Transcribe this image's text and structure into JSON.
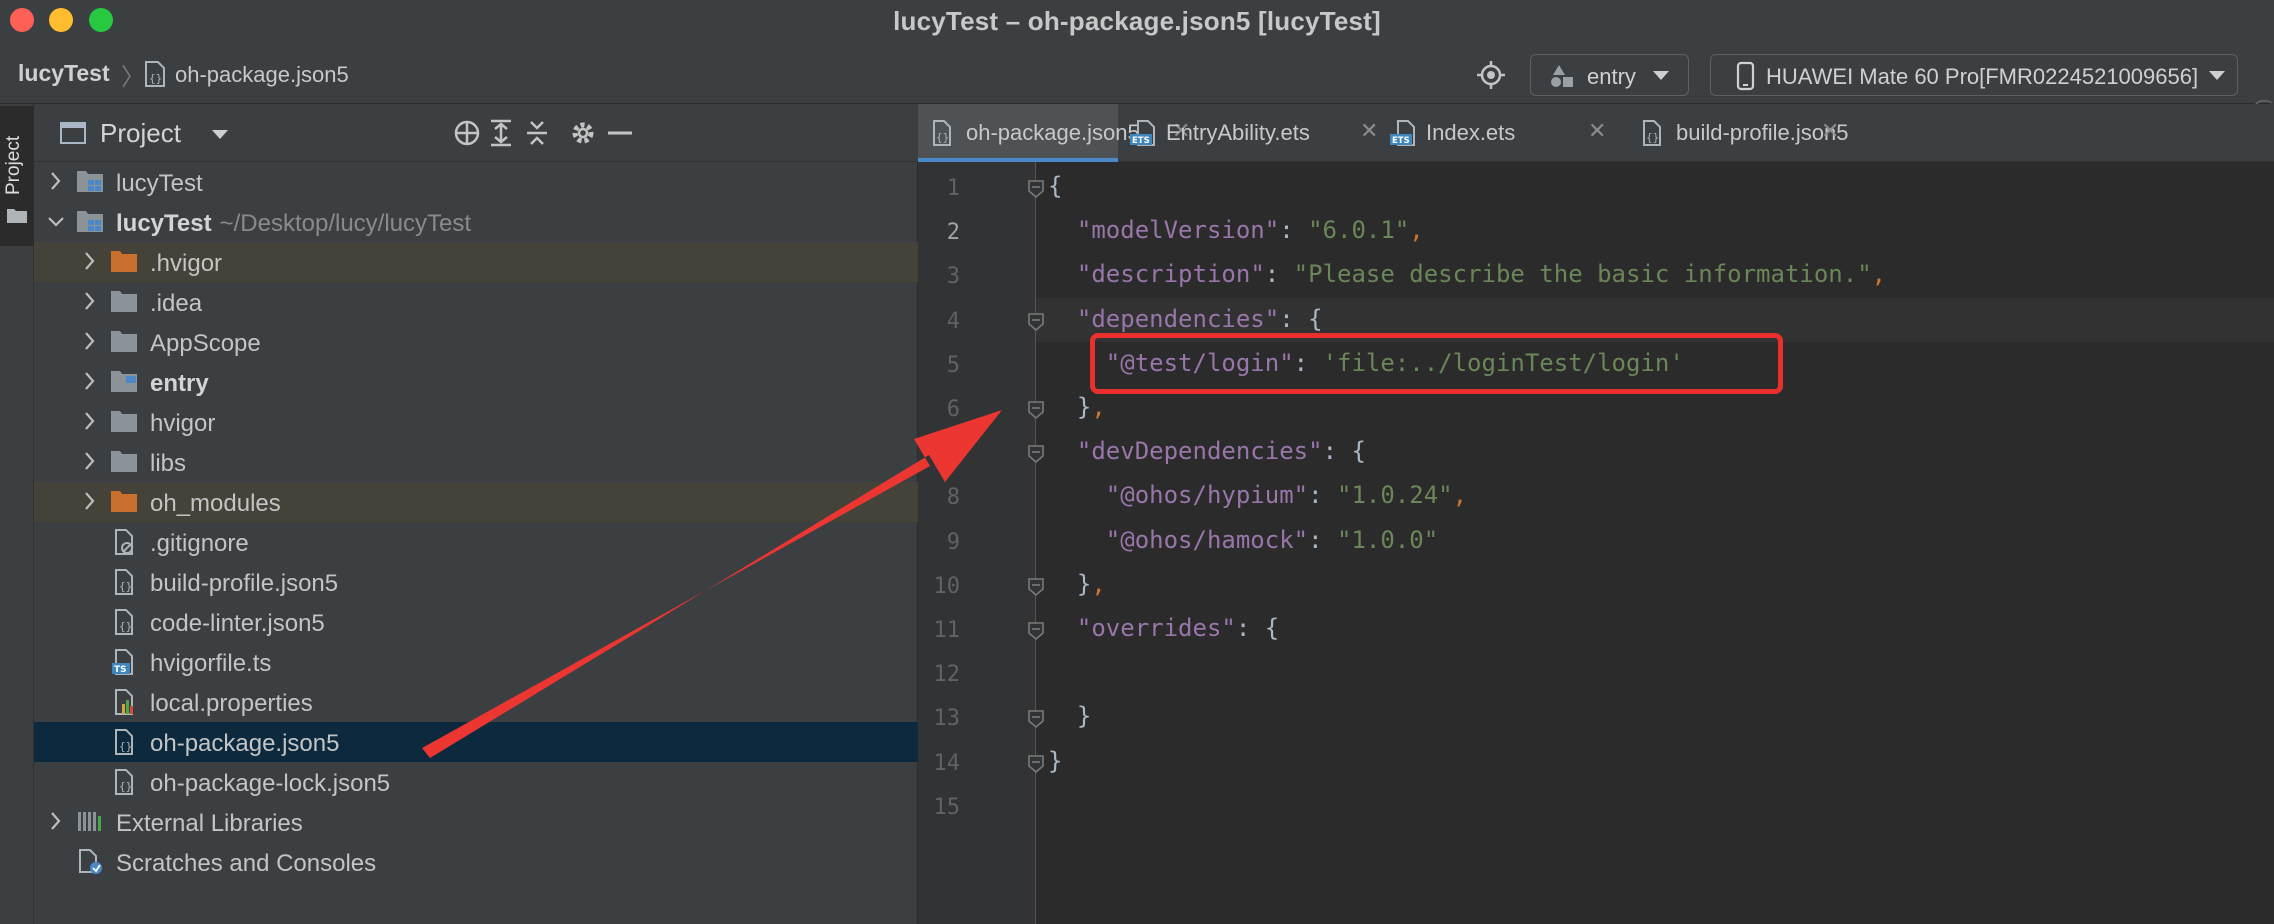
{
  "window": {
    "title": "lucyTest – oh-package.json5 [lucyTest]"
  },
  "navbar": {
    "project": "lucyTest",
    "file": "oh-package.json5",
    "run_config": "entry",
    "device": "HUAWEI Mate 60 Pro[FMR0224521009656]"
  },
  "stripe": {
    "label": "Project"
  },
  "panel": {
    "title": "Project",
    "tree": [
      {
        "label": "lucyTest",
        "path": "",
        "kind": "module",
        "expanded": false,
        "depth": 0,
        "bold": false
      },
      {
        "label": "lucyTest",
        "path": "~/Desktop/lucy/lucyTest",
        "kind": "module",
        "expanded": true,
        "depth": 0,
        "bold": true
      },
      {
        "label": ".hvigor",
        "kind": "folder-orange",
        "depth": 1,
        "chevron": true
      },
      {
        "label": ".idea",
        "kind": "folder",
        "depth": 1,
        "chevron": true
      },
      {
        "label": "AppScope",
        "kind": "folder",
        "depth": 1,
        "chevron": true
      },
      {
        "label": "entry",
        "kind": "folder-module",
        "depth": 1,
        "chevron": true,
        "bold": true
      },
      {
        "label": "hvigor",
        "kind": "folder",
        "depth": 1,
        "chevron": true
      },
      {
        "label": "libs",
        "kind": "folder",
        "depth": 1,
        "chevron": true
      },
      {
        "label": "oh_modules",
        "kind": "folder-orange",
        "depth": 1,
        "chevron": true
      },
      {
        "label": ".gitignore",
        "kind": "file-ignore",
        "depth": 1
      },
      {
        "label": "build-profile.json5",
        "kind": "file-json",
        "depth": 1
      },
      {
        "label": "code-linter.json5",
        "kind": "file-json",
        "depth": 1
      },
      {
        "label": "hvigorfile.ts",
        "kind": "file-ts",
        "depth": 1
      },
      {
        "label": "local.properties",
        "kind": "file-props",
        "depth": 1
      },
      {
        "label": "oh-package.json5",
        "kind": "file-json",
        "depth": 1,
        "selected": true
      },
      {
        "label": "oh-package-lock.json5",
        "kind": "file-json",
        "depth": 1
      },
      {
        "label": "External Libraries",
        "kind": "libraries",
        "depth": 0,
        "chevron": true
      },
      {
        "label": "Scratches and Consoles",
        "kind": "scratches",
        "depth": 0
      }
    ]
  },
  "tabs": [
    {
      "label": "oh-package.json5",
      "active": true,
      "icon": "json-file-icon"
    },
    {
      "label": "EntryAbility.ets",
      "active": false,
      "icon": "ets-file-icon"
    },
    {
      "label": "Index.ets",
      "active": false,
      "icon": "ets-file-icon"
    },
    {
      "label": "build-profile.json5",
      "active": false,
      "icon": "json-file-icon"
    }
  ],
  "editor": {
    "current_line": 2,
    "lines": [
      "{",
      "  \"modelVersion\": \"6.0.1\",",
      "  \"description\": \"Please describe the basic information.\",",
      "  \"dependencies\": {",
      "    \"@test/login\": 'file:../loginTest/login'",
      "  },",
      "  \"devDependencies\": {",
      "    \"@ohos/hypium\": \"1.0.24\",",
      "    \"@ohos/hamock\": \"1.0.0\"",
      "  },",
      "  \"overrides\": {",
      "",
      "  }",
      "}",
      ""
    ]
  },
  "colors": {
    "annotation": "#e8312c",
    "key": "#9876aa",
    "string": "#6a8759",
    "punctuation": "#cc7832",
    "selection": "#0d293e"
  }
}
